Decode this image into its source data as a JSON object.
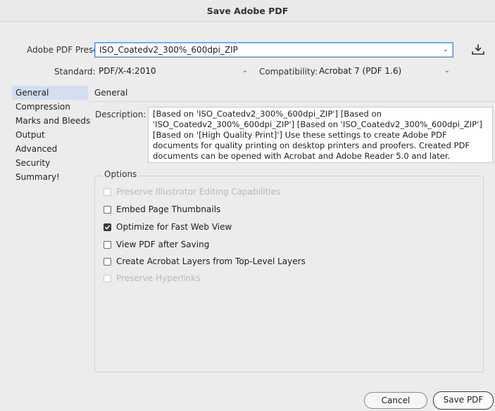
{
  "window": {
    "title": "Save Adobe PDF"
  },
  "preset": {
    "label": "Adobe PDF Preset:",
    "value": "ISO_Coatedv2_300%_600dpi_ZIP"
  },
  "standard": {
    "label": "Standard:",
    "value": "PDF/X-4:2010"
  },
  "compatibility": {
    "label": "Compatibility:",
    "value": "Acrobat 7 (PDF 1.6)"
  },
  "sidebar": {
    "items": [
      {
        "label": "General"
      },
      {
        "label": "Compression"
      },
      {
        "label": "Marks and Bleeds"
      },
      {
        "label": "Output"
      },
      {
        "label": "Advanced"
      },
      {
        "label": "Security"
      },
      {
        "label": "Summary!"
      }
    ]
  },
  "general": {
    "heading": "General",
    "description_label": "Description:",
    "description": "[Based on 'ISO_Coatedv2_300%_600dpi_ZIP'] [Based on 'ISO_Coatedv2_300%_600dpi_ZIP'] [Based on 'ISO_Coatedv2_300%_600dpi_ZIP'] [Based on '[High Quality Print]'] Use these settings to create Adobe PDF documents for quality printing on desktop printers and proofers.  Created PDF documents can be opened with Acrobat and Adobe Reader 5.0 and later."
  },
  "options": {
    "label": "Options",
    "items": [
      {
        "label": "Preserve Illustrator Editing Capabilities",
        "checked": false,
        "enabled": false
      },
      {
        "label": "Embed Page Thumbnails",
        "checked": false,
        "enabled": true
      },
      {
        "label": "Optimize for Fast Web View",
        "checked": true,
        "enabled": true
      },
      {
        "label": "View PDF after Saving",
        "checked": false,
        "enabled": true
      },
      {
        "label": "Create Acrobat Layers from Top-Level Layers",
        "checked": false,
        "enabled": true
      },
      {
        "label": "Preserve Hyperlinks",
        "checked": false,
        "enabled": false
      }
    ]
  },
  "buttons": {
    "cancel": "Cancel",
    "save": "Save PDF"
  },
  "icons": {
    "save_preset": "download-tray-icon",
    "dropdown": "chevron-down-icon",
    "check": "checkmark-icon"
  },
  "colors": {
    "selection": "#d3def0",
    "focus": "#5a8fd6"
  }
}
